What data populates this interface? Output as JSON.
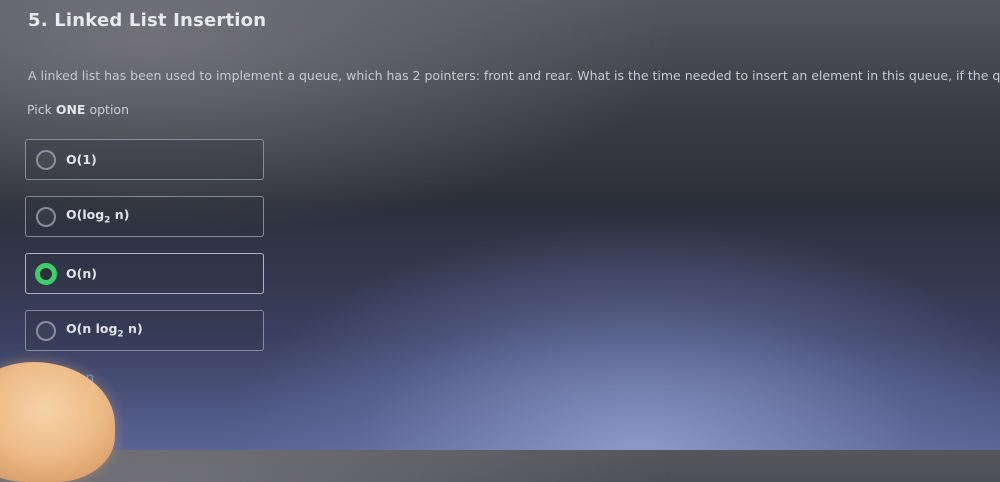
{
  "question": {
    "title": "5. Linked List Insertion",
    "text": "A linked list has been used to implement a queue, which has 2 pointers: front and rear. What is the time needed to insert an element in this queue, if the quer",
    "pick_prefix": "Pick",
    "pick_emphasis": "ONE",
    "pick_suffix": "option"
  },
  "options": [
    {
      "label": "O(1)",
      "selected": false
    },
    {
      "label_main": "O(log",
      "label_sub": "2",
      "label_end": " n)",
      "selected": false
    },
    {
      "label": "O(n)",
      "selected": true
    },
    {
      "label_main": "O(n log",
      "label_sub": "2",
      "label_end": " n)",
      "selected": false
    }
  ],
  "clear_selection_partial": "ction",
  "colors": {
    "selected_radio": "#3fcf6a",
    "link": "#5b9bd5",
    "title": "#e9eaef"
  }
}
